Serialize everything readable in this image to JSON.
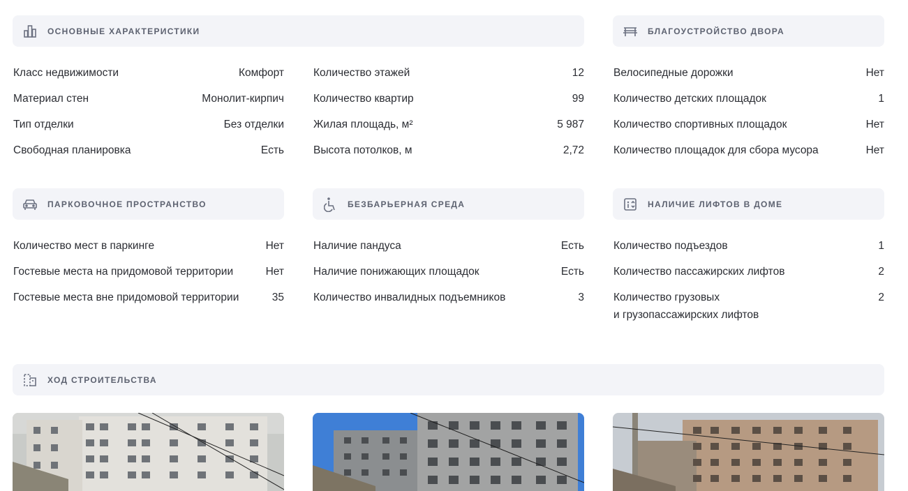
{
  "sections": {
    "main": {
      "title": "Основные характеристики",
      "icon": "building-chart-icon",
      "left_rows": [
        {
          "label": "Класс недвижимости",
          "value": "Комфорт"
        },
        {
          "label": "Материал стен",
          "value": "Монолит-кирпич"
        },
        {
          "label": "Тип отделки",
          "value": "Без отделки"
        },
        {
          "label": "Свободная планировка",
          "value": "Есть"
        }
      ],
      "right_rows": [
        {
          "label": "Количество этажей",
          "value": "12"
        },
        {
          "label": "Количество квартир",
          "value": "99"
        },
        {
          "label": "Жилая площадь, м²",
          "value": "5 987"
        },
        {
          "label": "Высота потолков, м",
          "value": "2,72"
        }
      ]
    },
    "yard": {
      "title": "Благоустройство двора",
      "icon": "bench-icon",
      "rows": [
        {
          "label": "Велосипедные дорожки",
          "value": "Нет"
        },
        {
          "label": "Количество детских площадок",
          "value": "1"
        },
        {
          "label": "Количество спортивных площадок",
          "value": "Нет"
        },
        {
          "label": "Количество площадок для сбора мусора",
          "value": "Нет"
        }
      ]
    },
    "parking": {
      "title": "Парковочное пространство",
      "icon": "car-icon",
      "rows": [
        {
          "label": "Количество мест в паркинге",
          "value": "Нет"
        },
        {
          "label": "Гостевые места на придомовой территории",
          "value": "Нет"
        },
        {
          "label": "Гостевые места вне придомовой территории",
          "value": "35"
        }
      ]
    },
    "accessibility": {
      "title": "Безбарьерная среда",
      "icon": "wheelchair-icon",
      "rows": [
        {
          "label": "Наличие пандуса",
          "value": "Есть"
        },
        {
          "label": "Наличие понижающих площадок",
          "value": "Есть"
        },
        {
          "label": "Количество инвалидных подъемников",
          "value": "3"
        }
      ]
    },
    "elevators": {
      "title": "Наличие лифтов в доме",
      "icon": "elevator-icon",
      "rows": [
        {
          "label": "Количество подъездов",
          "value": "1"
        },
        {
          "label": "Количество пассажирских лифтов",
          "value": "2"
        },
        {
          "label_line1": "Количество грузовых",
          "label_line2": "и грузопассажирских лифтов",
          "value": "2"
        }
      ]
    },
    "construction": {
      "title": "Ход строительства",
      "icon": "construction-progress-icon"
    }
  },
  "colors": {
    "header_bg": "#f3f4f8",
    "header_text": "#5d6270",
    "text": "#2b2d33"
  }
}
